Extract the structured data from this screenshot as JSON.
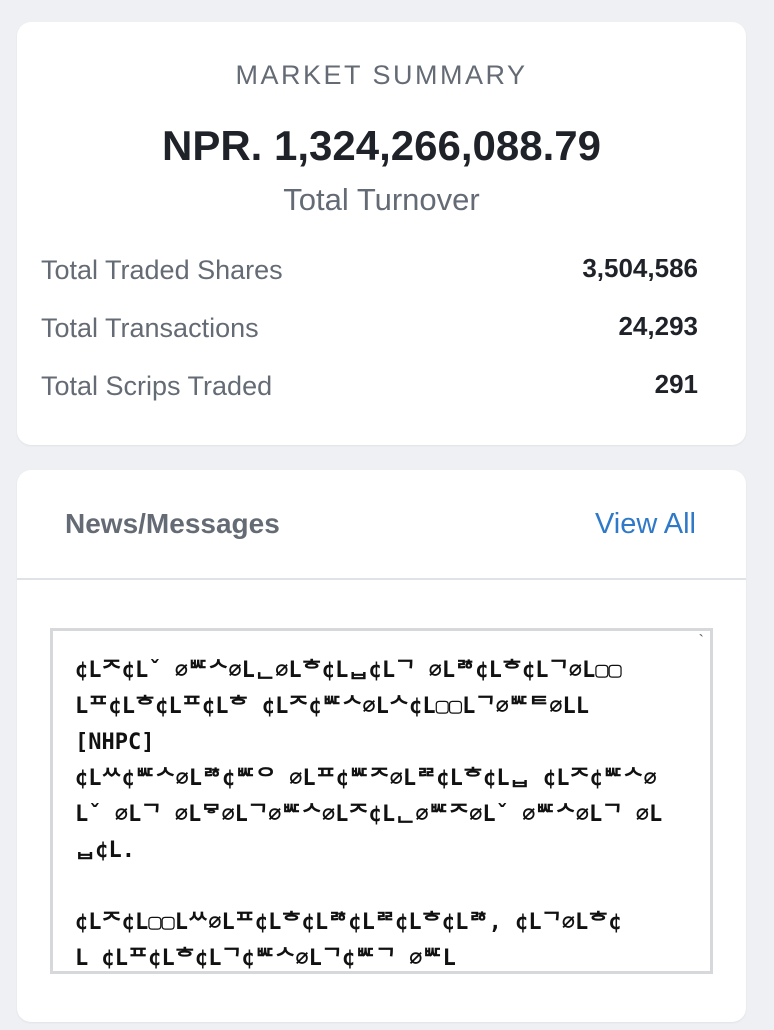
{
  "market_summary": {
    "heading": "MARKET SUMMARY",
    "total_turnover_value": "NPR. 1,324,266,088.79",
    "total_turnover_label": "Total Turnover",
    "stats": [
      {
        "label": "Total Traded Shares",
        "value": "3,504,586"
      },
      {
        "label": "Total Transactions",
        "value": "24,293"
      },
      {
        "label": "Total Scrips Traded",
        "value": "291"
      }
    ]
  },
  "news": {
    "title": "News/Messages",
    "view_all_label": "View All",
    "scroll_mark": "`",
    "message": "¢Lᄌ¢Lˇ ∅ᄣᄉ∅Lᆫ∅Lᄒ¢Lᆸ¢Lᄀ ∅Lᄚ¢Lᄒ¢Lᄀ∅L▢▢\nLᄑ¢Lᄒ¢Lᄑ¢Lᄒ ¢Lᄌ¢ᄣᄉ∅Lᄉ¢L▢▢Lᄀ∅ᄣᄐ∅LL\n[NHPC]\n¢Lᄊ¢ᄣᄉ∅Lᄚ¢ᄣᄋ ∅Lᄑ¢ᄣᄌ∅Lᄙ¢Lᄒ¢Lᆸ ¢Lᄌ¢ᄣᄉ∅\nLˇ ∅Lᄀ ∅Lᄝ∅Lᄀ∅ᄣᄉ∅Lᄌ¢Lᆫ∅ᄣᄌ∅Lˇ ∅ᄣᄉ∅Lᄀ ∅L\nᆸ¢L.\n\n¢Lᄌ¢L▢▢Lᄊ∅Lᄑ¢Lᄒ¢Lᄚ¢Lᄙ¢Lᄒ¢Lᄚ, ¢Lᄀ∅Lᄒ¢\nL ¢Lᄑ¢Lᄒ¢Lᄀ¢ᄣᄉ∅Lᄀ¢ᄣᄀ ∅ᄣL"
  }
}
